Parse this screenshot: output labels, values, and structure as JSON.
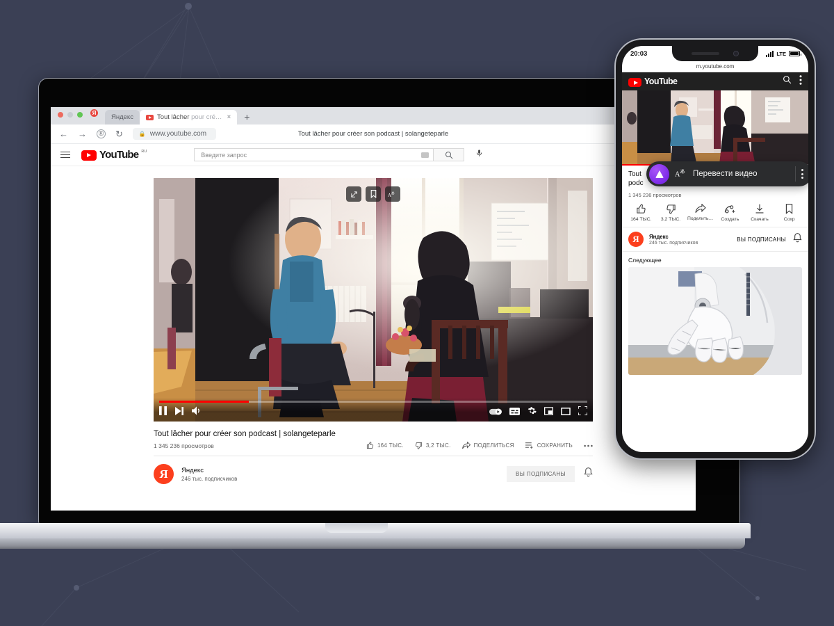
{
  "background": {
    "color": "#3b4055"
  },
  "laptop": {
    "browser": {
      "tabs": [
        {
          "label": "Яндекс",
          "active": false
        },
        {
          "label": "Tout lâcher",
          "label_dim": "pour cré…",
          "active": true
        }
      ],
      "new_tab_label": "+",
      "close_label": "×",
      "nav": {
        "back": "←",
        "forward": "→",
        "reload": "↻",
        "account": "®"
      },
      "url": "www.youtube.com",
      "lock_icon": "lock-icon",
      "page_title": "Tout lâcher pour créer son podcast | solangeteparle",
      "notification_badge": "Я"
    },
    "youtube": {
      "logo_text": "YouTube",
      "logo_superscript": "RU",
      "menu_icon": "hamburger-icon",
      "search_placeholder": "Введите запрос",
      "search_value": "",
      "keyboard_icon": "keyboard-icon",
      "search_icon": "search-icon",
      "mic_icon": "microphone-icon",
      "camera_icon": "create-video-icon"
    },
    "player": {
      "overlay_buttons": [
        "share-external-icon",
        "bookmark-icon",
        "translate-icon"
      ],
      "progress_percent": 21,
      "controls_left": [
        "pause-icon",
        "next-icon",
        "volume-icon"
      ],
      "controls_right": [
        "autoplay-toggle-icon",
        "subtitles-icon",
        "settings-gear-icon",
        "miniplayer-icon",
        "theater-mode-icon",
        "fullscreen-icon"
      ]
    },
    "video": {
      "title": "Tout lâcher pour créer son podcast | solangeteparle",
      "views": "1 345 236 просмотров",
      "actions": [
        {
          "icon": "thumbs-up-icon",
          "label": "164 тыс."
        },
        {
          "icon": "thumbs-down-icon",
          "label": "3,2 тыс."
        },
        {
          "icon": "share-icon",
          "label": "Поделиться"
        },
        {
          "icon": "save-playlist-icon",
          "label": "Сохранить"
        },
        {
          "icon": "more-dots-icon",
          "label": ""
        }
      ]
    },
    "channel": {
      "avatar_letter": "Я",
      "name": "Яндекс",
      "subscribers": "246 тыс. подписчиков",
      "subscribe_label": "Вы подписаны",
      "bell_icon": "notification-bell-icon"
    }
  },
  "phone": {
    "status": {
      "time": "20:03",
      "network": "LTE",
      "signal_icon": "signal-bars-icon",
      "battery_icon": "battery-icon"
    },
    "url": "m.youtube.com",
    "header": {
      "logo_text": "YouTube",
      "search_icon": "search-icon",
      "menu_icon": "kebab-menu-icon"
    },
    "player": {
      "progress_percent": 28
    },
    "video": {
      "title_line1": "Tout",
      "title_line2": "podc",
      "views": "1 345 236 просмотров",
      "actions": [
        {
          "icon": "thumbs-up-icon",
          "label": "164 ТЫС."
        },
        {
          "icon": "thumbs-down-icon",
          "label": "3,2 ТЫС."
        },
        {
          "icon": "share-icon",
          "label": "Поделить…"
        },
        {
          "icon": "remix-create-icon",
          "label": "Создать"
        },
        {
          "icon": "download-icon",
          "label": "Скачать"
        },
        {
          "icon": "save-icon",
          "label": "Сохр"
        }
      ]
    },
    "channel": {
      "avatar_letter": "Я",
      "name": "Яндекс",
      "subscribers": "246 тыс. подписчиков",
      "subscribe_label": "ВЫ ПОДПИСАНЫ",
      "bell_icon": "notification-bell-icon"
    },
    "next_section_label": "Следующее",
    "translate_banner": {
      "assistant_icon": "alice-assistant-icon",
      "translate_icon": "translate-icon",
      "label": "Перевести видео",
      "menu_icon": "kebab-menu-icon",
      "background_color": "#2b2c2e",
      "accent_color": "#7c2ae8"
    }
  }
}
